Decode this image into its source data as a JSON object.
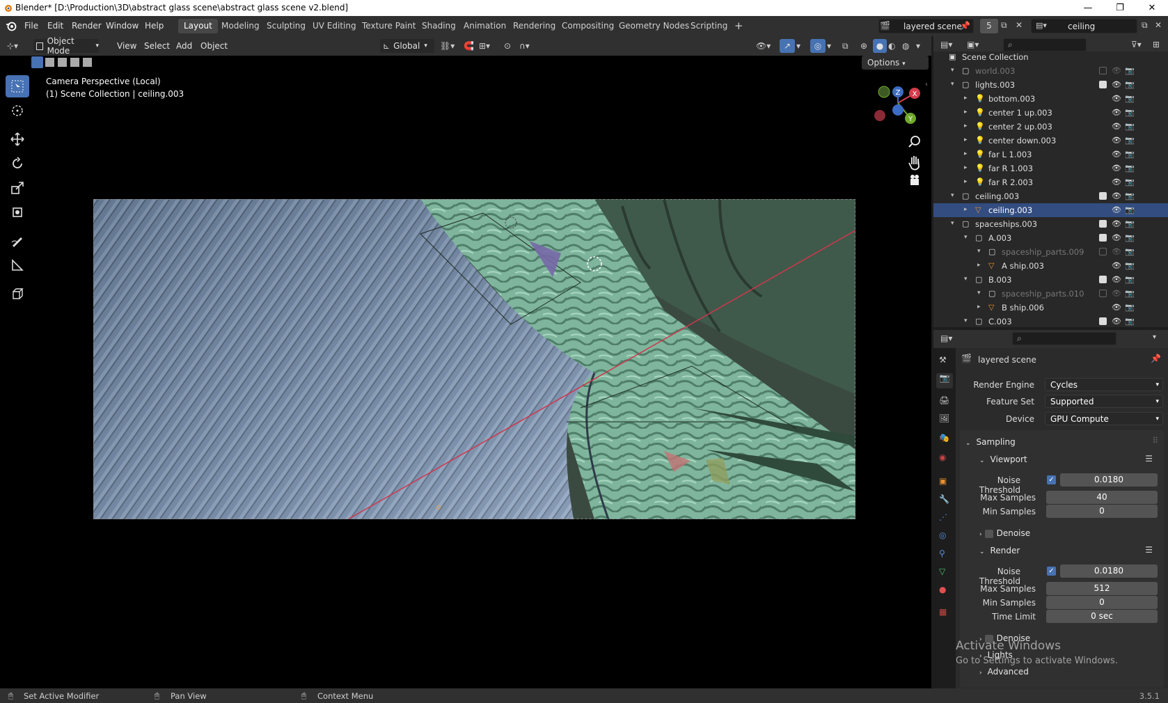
{
  "window": {
    "title": "Blender* [D:\\Production\\3D\\abstract glass scene\\abstract glass scene v2.blend]",
    "minimize": "—",
    "maximize": "❐",
    "close": "✕"
  },
  "menu": [
    "File",
    "Edit",
    "Render",
    "Window",
    "Help"
  ],
  "workspaces": [
    "Layout",
    "Modeling",
    "Sculpting",
    "UV Editing",
    "Texture Paint",
    "Shading",
    "Animation",
    "Rendering",
    "Compositing",
    "Geometry Nodes",
    "Scripting"
  ],
  "workspace_add": "+",
  "scene": {
    "name": "layered scene",
    "users": "5"
  },
  "view_layer": {
    "name": "ceiling"
  },
  "viewport_header": {
    "mode": "Object Mode",
    "menus": [
      "View",
      "Select",
      "Add",
      "Object"
    ],
    "orientation": "Global",
    "options": "Options"
  },
  "viewport": {
    "overlay_line1": "Camera Perspective (Local)",
    "overlay_line2": "(1) Scene Collection | ceiling.003"
  },
  "gizmo": {
    "x": "X",
    "y": "Y",
    "z": "Z"
  },
  "outliner": {
    "search_placeholder": "",
    "rows": [
      {
        "label": "Scene Collection",
        "indent": 0,
        "type": "scene"
      },
      {
        "label": "world.003",
        "indent": 1,
        "type": "collection",
        "dim": true
      },
      {
        "label": "lights.003",
        "indent": 1,
        "type": "collection"
      },
      {
        "label": "bottom.003",
        "indent": 2,
        "type": "light"
      },
      {
        "label": "center 1 up.003",
        "indent": 2,
        "type": "light"
      },
      {
        "label": "center 2 up.003",
        "indent": 2,
        "type": "light"
      },
      {
        "label": "center down.003",
        "indent": 2,
        "type": "light"
      },
      {
        "label": "far L 1.003",
        "indent": 2,
        "type": "light"
      },
      {
        "label": "far R 1.003",
        "indent": 2,
        "type": "light"
      },
      {
        "label": "far R 2.003",
        "indent": 2,
        "type": "light"
      },
      {
        "label": "ceiling.003",
        "indent": 1,
        "type": "collection"
      },
      {
        "label": "ceiling.003",
        "indent": 2,
        "type": "mesh",
        "selected": true
      },
      {
        "label": "spaceships.003",
        "indent": 1,
        "type": "collection"
      },
      {
        "label": "A.003",
        "indent": 2,
        "type": "collection"
      },
      {
        "label": "spaceship_parts.009",
        "indent": 3,
        "type": "collection",
        "dim": true
      },
      {
        "label": "A ship.003",
        "indent": 3,
        "type": "mesh"
      },
      {
        "label": "B.003",
        "indent": 2,
        "type": "collection"
      },
      {
        "label": "spaceship_parts.010",
        "indent": 3,
        "type": "collection",
        "dim": true
      },
      {
        "label": "B ship.006",
        "indent": 3,
        "type": "mesh"
      },
      {
        "label": "C.003",
        "indent": 2,
        "type": "collection"
      }
    ]
  },
  "properties": {
    "scene_name": "layered scene",
    "render_engine_label": "Render Engine",
    "render_engine": "Cycles",
    "feature_set_label": "Feature Set",
    "feature_set": "Supported",
    "device_label": "Device",
    "device": "GPU Compute",
    "sampling": "Sampling",
    "viewport": "Viewport",
    "vp_noise_label": "Noise Threshold",
    "vp_noise": "0.0180",
    "vp_max_label": "Max Samples",
    "vp_max": "40",
    "vp_min_label": "Min Samples",
    "vp_min": "0",
    "denoise": "Denoise",
    "render": "Render",
    "r_noise_label": "Noise Threshold",
    "r_noise": "0.0180",
    "r_max_label": "Max Samples",
    "r_max": "512",
    "r_min_label": "Min Samples",
    "r_min": "0",
    "time_limit_label": "Time Limit",
    "time_limit": "0 sec",
    "denoise2": "Denoise",
    "lights": "Lights",
    "advanced": "Advanced"
  },
  "watermark": {
    "line1": "Activate Windows",
    "line2": "Go to Settings to activate Windows."
  },
  "status": {
    "left": "Set Active Modifier",
    "mid": "Pan View",
    "right": "Context Menu",
    "version": "3.5.1"
  }
}
